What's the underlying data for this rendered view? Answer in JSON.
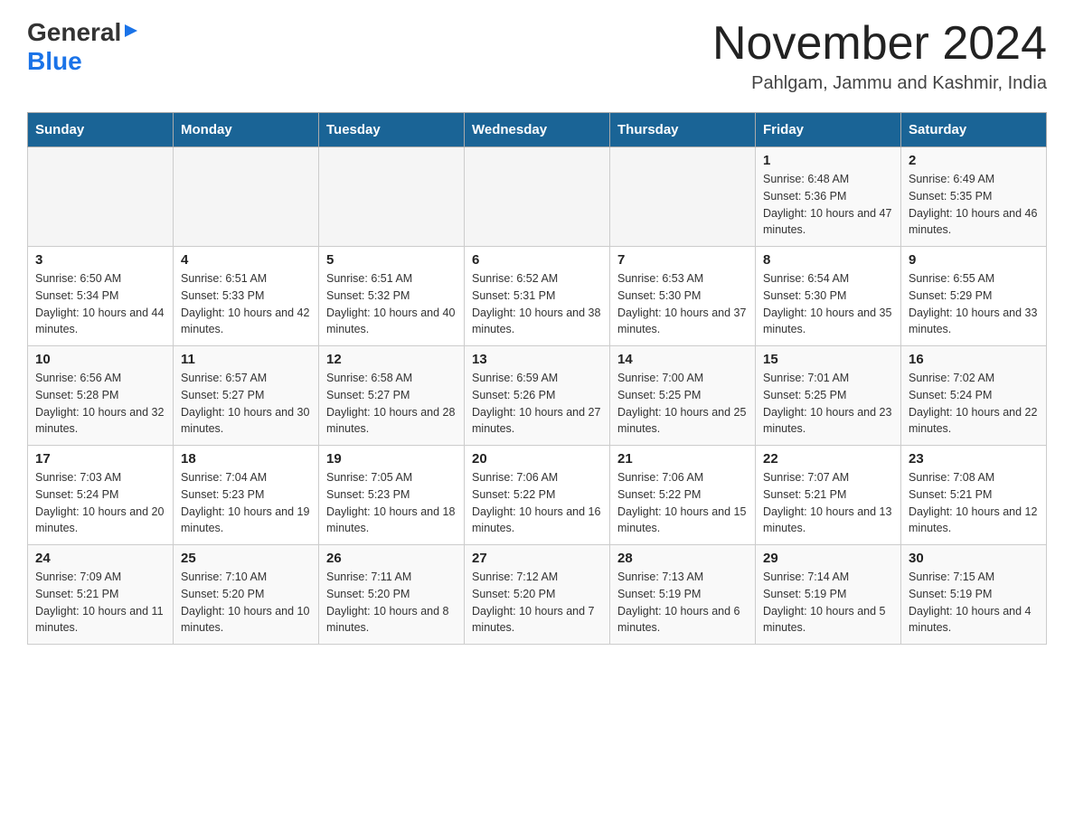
{
  "header": {
    "logo_general": "General",
    "logo_blue": "Blue",
    "month_title": "November 2024",
    "location": "Pahlgam, Jammu and Kashmir, India"
  },
  "weekdays": [
    "Sunday",
    "Monday",
    "Tuesday",
    "Wednesday",
    "Thursday",
    "Friday",
    "Saturday"
  ],
  "rows": [
    {
      "cells": [
        {
          "day": "",
          "info": ""
        },
        {
          "day": "",
          "info": ""
        },
        {
          "day": "",
          "info": ""
        },
        {
          "day": "",
          "info": ""
        },
        {
          "day": "",
          "info": ""
        },
        {
          "day": "1",
          "info": "Sunrise: 6:48 AM\nSunset: 5:36 PM\nDaylight: 10 hours and 47 minutes."
        },
        {
          "day": "2",
          "info": "Sunrise: 6:49 AM\nSunset: 5:35 PM\nDaylight: 10 hours and 46 minutes."
        }
      ]
    },
    {
      "cells": [
        {
          "day": "3",
          "info": "Sunrise: 6:50 AM\nSunset: 5:34 PM\nDaylight: 10 hours and 44 minutes."
        },
        {
          "day": "4",
          "info": "Sunrise: 6:51 AM\nSunset: 5:33 PM\nDaylight: 10 hours and 42 minutes."
        },
        {
          "day": "5",
          "info": "Sunrise: 6:51 AM\nSunset: 5:32 PM\nDaylight: 10 hours and 40 minutes."
        },
        {
          "day": "6",
          "info": "Sunrise: 6:52 AM\nSunset: 5:31 PM\nDaylight: 10 hours and 38 minutes."
        },
        {
          "day": "7",
          "info": "Sunrise: 6:53 AM\nSunset: 5:30 PM\nDaylight: 10 hours and 37 minutes."
        },
        {
          "day": "8",
          "info": "Sunrise: 6:54 AM\nSunset: 5:30 PM\nDaylight: 10 hours and 35 minutes."
        },
        {
          "day": "9",
          "info": "Sunrise: 6:55 AM\nSunset: 5:29 PM\nDaylight: 10 hours and 33 minutes."
        }
      ]
    },
    {
      "cells": [
        {
          "day": "10",
          "info": "Sunrise: 6:56 AM\nSunset: 5:28 PM\nDaylight: 10 hours and 32 minutes."
        },
        {
          "day": "11",
          "info": "Sunrise: 6:57 AM\nSunset: 5:27 PM\nDaylight: 10 hours and 30 minutes."
        },
        {
          "day": "12",
          "info": "Sunrise: 6:58 AM\nSunset: 5:27 PM\nDaylight: 10 hours and 28 minutes."
        },
        {
          "day": "13",
          "info": "Sunrise: 6:59 AM\nSunset: 5:26 PM\nDaylight: 10 hours and 27 minutes."
        },
        {
          "day": "14",
          "info": "Sunrise: 7:00 AM\nSunset: 5:25 PM\nDaylight: 10 hours and 25 minutes."
        },
        {
          "day": "15",
          "info": "Sunrise: 7:01 AM\nSunset: 5:25 PM\nDaylight: 10 hours and 23 minutes."
        },
        {
          "day": "16",
          "info": "Sunrise: 7:02 AM\nSunset: 5:24 PM\nDaylight: 10 hours and 22 minutes."
        }
      ]
    },
    {
      "cells": [
        {
          "day": "17",
          "info": "Sunrise: 7:03 AM\nSunset: 5:24 PM\nDaylight: 10 hours and 20 minutes."
        },
        {
          "day": "18",
          "info": "Sunrise: 7:04 AM\nSunset: 5:23 PM\nDaylight: 10 hours and 19 minutes."
        },
        {
          "day": "19",
          "info": "Sunrise: 7:05 AM\nSunset: 5:23 PM\nDaylight: 10 hours and 18 minutes."
        },
        {
          "day": "20",
          "info": "Sunrise: 7:06 AM\nSunset: 5:22 PM\nDaylight: 10 hours and 16 minutes."
        },
        {
          "day": "21",
          "info": "Sunrise: 7:06 AM\nSunset: 5:22 PM\nDaylight: 10 hours and 15 minutes."
        },
        {
          "day": "22",
          "info": "Sunrise: 7:07 AM\nSunset: 5:21 PM\nDaylight: 10 hours and 13 minutes."
        },
        {
          "day": "23",
          "info": "Sunrise: 7:08 AM\nSunset: 5:21 PM\nDaylight: 10 hours and 12 minutes."
        }
      ]
    },
    {
      "cells": [
        {
          "day": "24",
          "info": "Sunrise: 7:09 AM\nSunset: 5:21 PM\nDaylight: 10 hours and 11 minutes."
        },
        {
          "day": "25",
          "info": "Sunrise: 7:10 AM\nSunset: 5:20 PM\nDaylight: 10 hours and 10 minutes."
        },
        {
          "day": "26",
          "info": "Sunrise: 7:11 AM\nSunset: 5:20 PM\nDaylight: 10 hours and 8 minutes."
        },
        {
          "day": "27",
          "info": "Sunrise: 7:12 AM\nSunset: 5:20 PM\nDaylight: 10 hours and 7 minutes."
        },
        {
          "day": "28",
          "info": "Sunrise: 7:13 AM\nSunset: 5:19 PM\nDaylight: 10 hours and 6 minutes."
        },
        {
          "day": "29",
          "info": "Sunrise: 7:14 AM\nSunset: 5:19 PM\nDaylight: 10 hours and 5 minutes."
        },
        {
          "day": "30",
          "info": "Sunrise: 7:15 AM\nSunset: 5:19 PM\nDaylight: 10 hours and 4 minutes."
        }
      ]
    }
  ]
}
